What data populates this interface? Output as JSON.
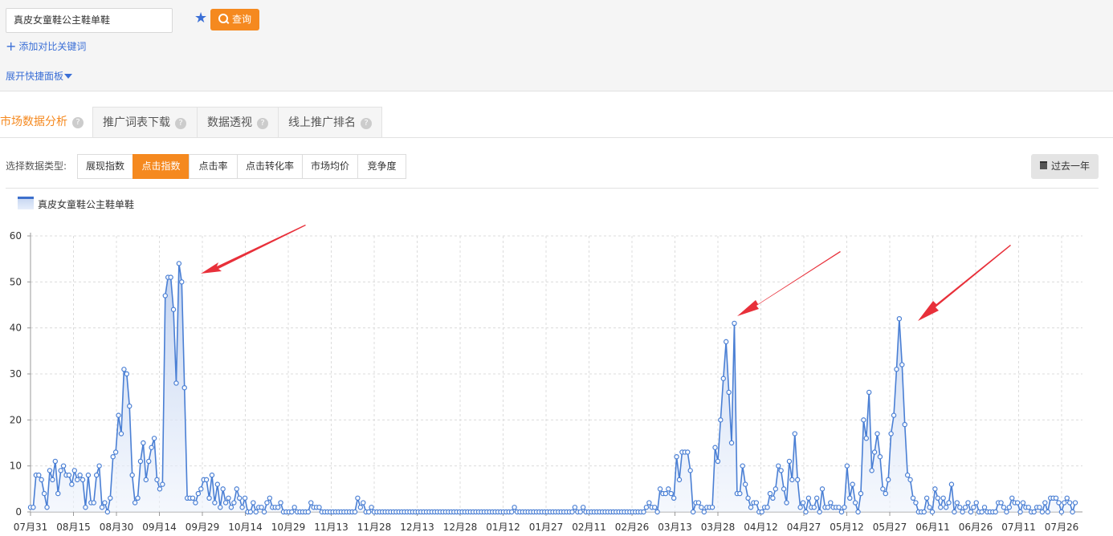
{
  "search": {
    "value": "真皮女童鞋公主鞋单鞋",
    "query_label": "查询"
  },
  "links": {
    "add_compare": "添加对比关键词",
    "expand_panel": "展开快捷面板"
  },
  "tabs": [
    {
      "label": "市场数据分析",
      "active": true
    },
    {
      "label": "推广词表下载",
      "active": false
    },
    {
      "label": "数据透视",
      "active": false
    },
    {
      "label": "线上推广排名",
      "active": false
    }
  ],
  "data_type": {
    "label": "选择数据类型:",
    "options": [
      "展现指数",
      "点击指数",
      "点击率",
      "点击转化率",
      "市场均价",
      "竞争度"
    ],
    "selected": "点击指数"
  },
  "period_button": "过去一年",
  "colors": {
    "accent": "#f5891f",
    "series": "#4a7fd4",
    "link": "#3b6fd6"
  },
  "icons": [
    "star-icon",
    "search-icon",
    "plus-icon",
    "caret-down-icon",
    "help-icon",
    "calendar-icon",
    "arrow-annotation"
  ],
  "chart_data": {
    "type": "area",
    "legend": {
      "position": "top-left"
    },
    "grid": true,
    "ylim": [
      0,
      60
    ],
    "yticks": [
      0,
      10,
      20,
      30,
      40,
      50,
      60
    ],
    "xticks": [
      "07月31",
      "08月15",
      "08月30",
      "09月14",
      "09月29",
      "10月14",
      "10月29",
      "11月13",
      "11月28",
      "12月13",
      "12月28",
      "01月12",
      "01月27",
      "02月11",
      "02月26",
      "03月13",
      "03月28",
      "04月12",
      "04月27",
      "05月12",
      "05月27",
      "06月11",
      "06月26",
      "07月11",
      "07月26"
    ],
    "series": [
      {
        "name": "真皮女童鞋公主鞋单鞋",
        "start_date": "07月31",
        "values": [
          1,
          1,
          8,
          8,
          7,
          4,
          1,
          9,
          7,
          11,
          4,
          9,
          10,
          8,
          8,
          6,
          9,
          7,
          8,
          7,
          1,
          8,
          2,
          2,
          8,
          10,
          1,
          2,
          0,
          3,
          12,
          13,
          21,
          17,
          31,
          30,
          23,
          8,
          2,
          3,
          11,
          15,
          7,
          11,
          14,
          16,
          7,
          5,
          6,
          47,
          51,
          51,
          44,
          28,
          54,
          50,
          27,
          3,
          3,
          3,
          2,
          4,
          5,
          7,
          7,
          3,
          8,
          2,
          6,
          1,
          5,
          2,
          3,
          1,
          2,
          5,
          3,
          1,
          3,
          0,
          0,
          2,
          0,
          1,
          1,
          0,
          2,
          3,
          1,
          1,
          1,
          2,
          0,
          0,
          0,
          0,
          1,
          0,
          0,
          0,
          0,
          0,
          2,
          1,
          1,
          1,
          0,
          0,
          0,
          0,
          0,
          0,
          0,
          0,
          0,
          0,
          0,
          0,
          0,
          3,
          1,
          2,
          0,
          0,
          1,
          0,
          0,
          0,
          0,
          0,
          0,
          0,
          0,
          0,
          0,
          0,
          0,
          0,
          0,
          0,
          0,
          0,
          0,
          0,
          0,
          0,
          0,
          0,
          0,
          0,
          0,
          0,
          0,
          0,
          0,
          0,
          0,
          0,
          0,
          0,
          0,
          0,
          0,
          0,
          0,
          0,
          0,
          0,
          0,
          0,
          0,
          0,
          0,
          0,
          0,
          0,
          1,
          0,
          0,
          0,
          0,
          0,
          0,
          0,
          0,
          0,
          0,
          0,
          0,
          0,
          0,
          0,
          0,
          0,
          0,
          0,
          0,
          0,
          1,
          0,
          0,
          1,
          0,
          0,
          0,
          0,
          0,
          0,
          0,
          0,
          0,
          0,
          0,
          0,
          0,
          0,
          0,
          0,
          0,
          0,
          0,
          0,
          0,
          0,
          1,
          2,
          1,
          1,
          0,
          5,
          4,
          4,
          5,
          4,
          3,
          12,
          7,
          13,
          13,
          13,
          9,
          0,
          2,
          2,
          1,
          0,
          1,
          1,
          1,
          14,
          11,
          20,
          29,
          37,
          26,
          15,
          41,
          4,
          4,
          10,
          6,
          3,
          1,
          2,
          2,
          0,
          0,
          1,
          1,
          4,
          3,
          5,
          10,
          9,
          5,
          2,
          11,
          7,
          17,
          7,
          1,
          2,
          0,
          3,
          1,
          1,
          3,
          0,
          5,
          1,
          1,
          2,
          1,
          1,
          1,
          0,
          1,
          10,
          3,
          6,
          2,
          0,
          4,
          20,
          16,
          26,
          9,
          13,
          17,
          12,
          5,
          4,
          7,
          17,
          21,
          31,
          42,
          32,
          19,
          8,
          7,
          3,
          2,
          0,
          0,
          0,
          3,
          1,
          0,
          5,
          3,
          1,
          3,
          1,
          2,
          6,
          0,
          2,
          1,
          0,
          1,
          2,
          0,
          1,
          2,
          0,
          0,
          1,
          0,
          0,
          0,
          0,
          2,
          2,
          1,
          0,
          1,
          3,
          2,
          2,
          0,
          2,
          1,
          1,
          0,
          0,
          1,
          1,
          0,
          2,
          0,
          3,
          3,
          3,
          2,
          0,
          2,
          3,
          2,
          0,
          2
        ]
      }
    ]
  }
}
